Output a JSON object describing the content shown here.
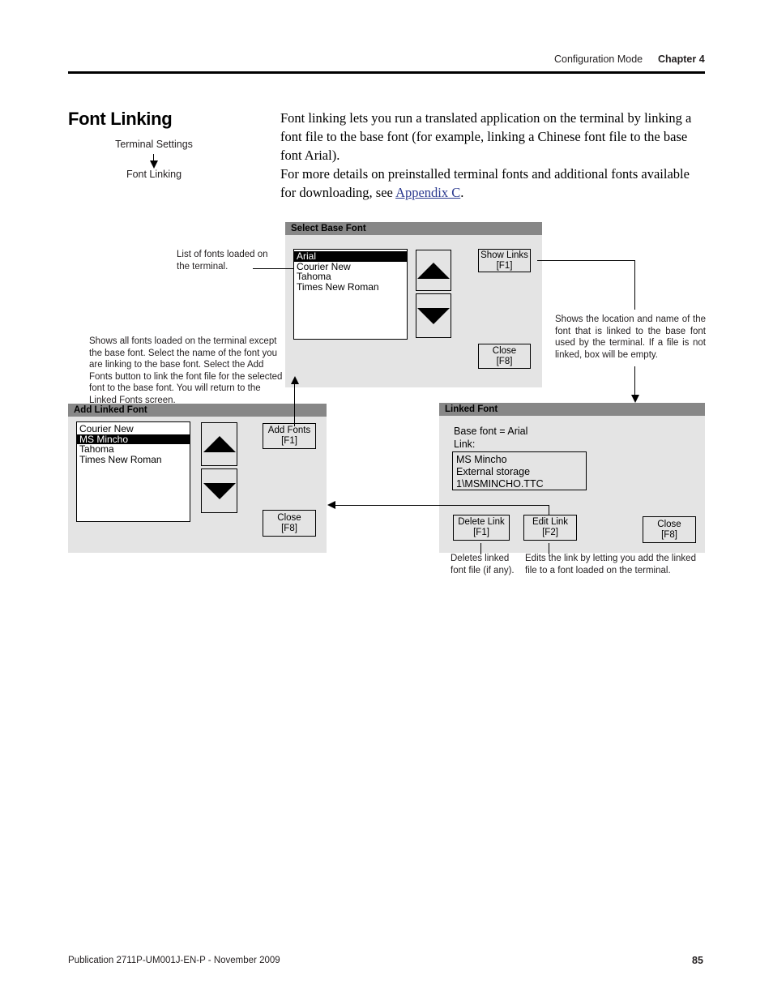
{
  "header": {
    "mode": "Configuration Mode",
    "chapter": "Chapter 4"
  },
  "section": {
    "title": "Font Linking",
    "breadcrumb_parent": "Terminal Settings",
    "breadcrumb_child": "Font Linking"
  },
  "body": {
    "para1": "Font linking lets you run a translated application on the terminal by linking a font file to the base font (for example, linking a Chinese font file to the base font Arial).",
    "para2_before": "For more details on preinstalled terminal fonts and additional fonts available for downloading, see ",
    "para2_link": "Appendix C",
    "para2_after": "."
  },
  "select_base_font": {
    "title": "Select Base Font",
    "fonts": [
      "Arial",
      "Courier New",
      "Tahoma",
      "Times New Roman"
    ],
    "selected_index": 0,
    "scroll_up_icon": "triangle-up-icon",
    "scroll_down_icon": "triangle-down-icon",
    "buttons": [
      {
        "label": "Show Links",
        "key": "[F1]"
      },
      {
        "label": "Close",
        "key": "[F8]"
      }
    ]
  },
  "add_linked_font": {
    "title": "Add Linked Font",
    "fonts": [
      "Courier New",
      "MS Mincho",
      "Tahoma",
      "Times New Roman"
    ],
    "selected_index": 1,
    "scroll_up_icon": "triangle-up-icon",
    "scroll_down_icon": "triangle-down-icon",
    "buttons": [
      {
        "label": "Add Fonts",
        "key": "[F1]"
      },
      {
        "label": "Close",
        "key": "[F8]"
      }
    ]
  },
  "linked_font": {
    "title": "Linked Font",
    "base_font_line": "Base font = Arial",
    "link_label": "Link:",
    "link_font_name": "MS Mincho",
    "link_path": "External storage 1\\MSMINCHO.TTC",
    "buttons": [
      {
        "label": "Delete Link",
        "key": "[F1]"
      },
      {
        "label": "Edit Link",
        "key": "[F2]"
      },
      {
        "label": "Close",
        "key": "[F8]"
      }
    ]
  },
  "annotations": {
    "font_list": "List of fonts loaded on the terminal.",
    "add_linked_font_desc": "Shows all fonts loaded on the terminal except the base font. Select the name of the font you are linking to the base font. Select the Add Fonts button to link the font file for the selected font to the base font. You will return to the Linked Fonts screen.",
    "show_links_desc": "Shows the location and name of the font that is linked to the base font used by the terminal.  If a file is not linked, box will be empty.",
    "delete_link_desc": "Deletes linked font file (if any).",
    "edit_link_desc": "Edits the link by letting you add the linked file to a font loaded on the terminal."
  },
  "footer": {
    "publication": "Publication 2711P-UM001J-EN-P - November 2009",
    "page_number": "85"
  }
}
